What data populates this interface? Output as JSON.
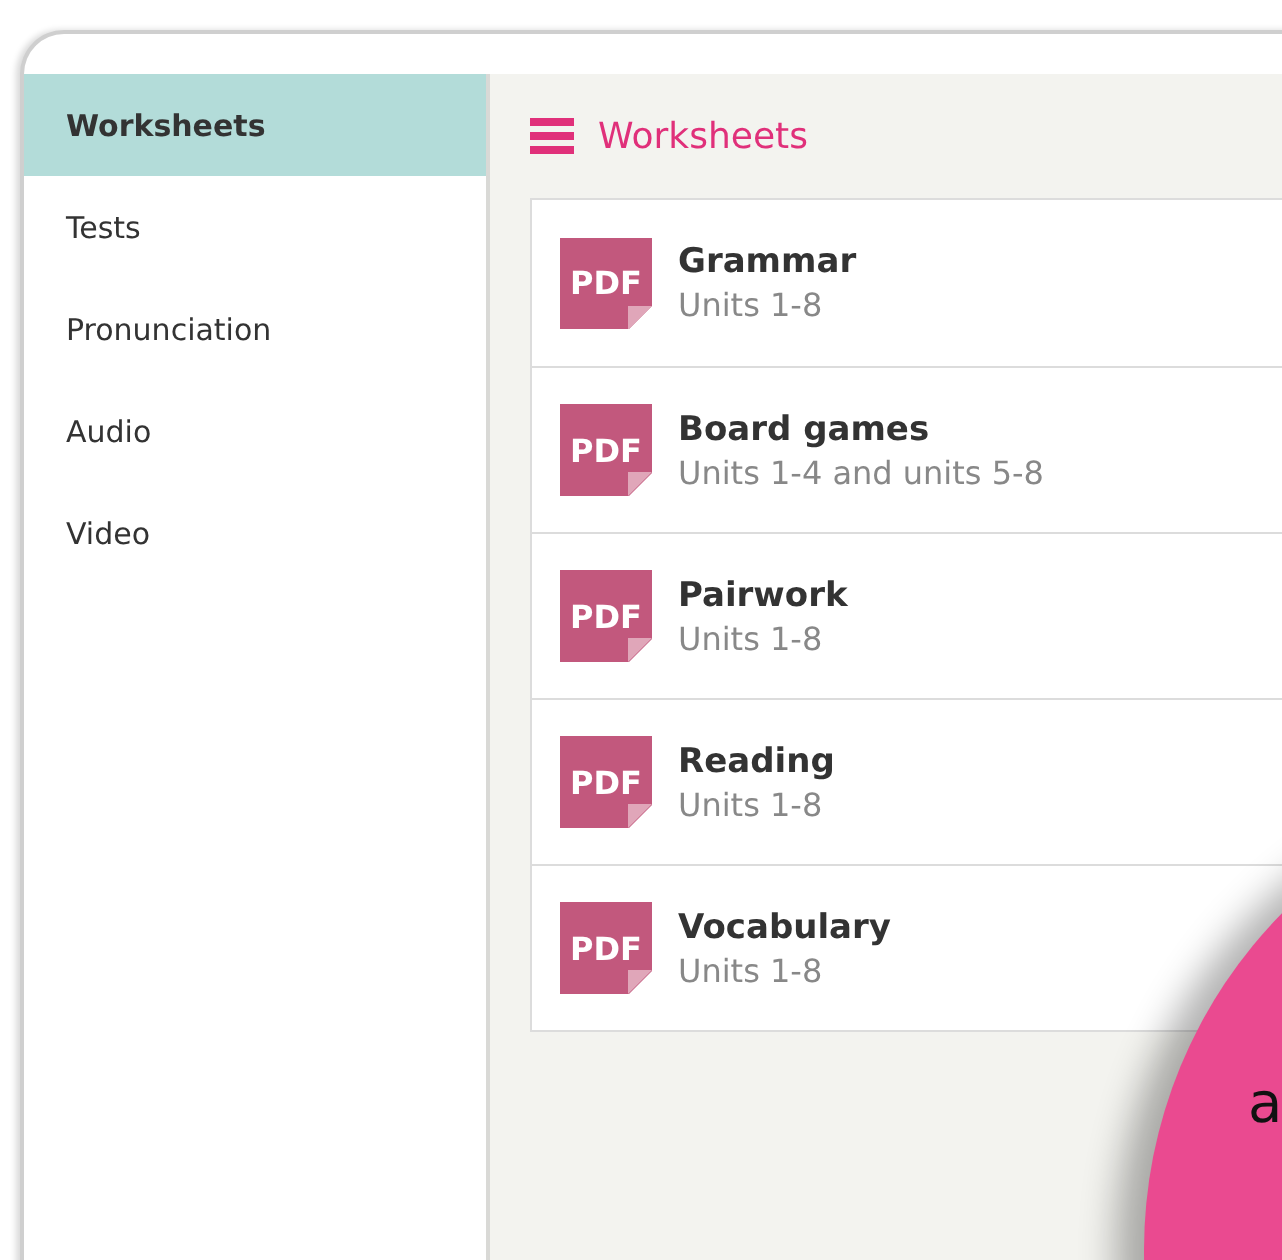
{
  "sidebar": {
    "items": [
      {
        "label": "Worksheets",
        "selected": true
      },
      {
        "label": "Tests",
        "selected": false
      },
      {
        "label": "Pronunciation",
        "selected": false
      },
      {
        "label": "Audio",
        "selected": false
      },
      {
        "label": "Video",
        "selected": false
      }
    ]
  },
  "header": {
    "title": "Worksheets"
  },
  "files": [
    {
      "badge": "PDF",
      "title": "Grammar",
      "subtitle": "Units 1-8"
    },
    {
      "badge": "PDF",
      "title": "Board games",
      "subtitle": "Units 1-4 and units 5-8"
    },
    {
      "badge": "PDF",
      "title": "Pairwork",
      "subtitle": "Units 1-8"
    },
    {
      "badge": "PDF",
      "title": "Reading",
      "subtitle": "Units 1-8"
    },
    {
      "badge": "PDF",
      "title": "Vocabulary",
      "subtitle": "Units 1-8"
    }
  ],
  "overlay": {
    "text": "a"
  }
}
